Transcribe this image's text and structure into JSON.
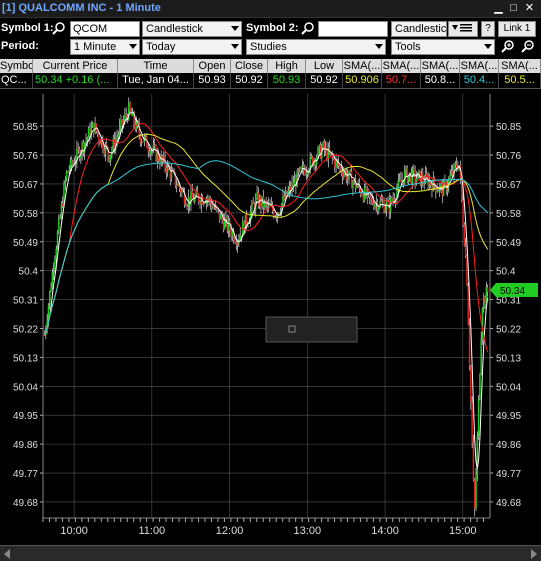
{
  "window": {
    "title": "[1] QUALCOMM INC - 1 Minute",
    "buttons": [
      "▁",
      "□",
      "✕"
    ]
  },
  "toolbar": {
    "symbol1_label": "Symbol 1:",
    "symbol1_value": "QCOM",
    "chart_type": "Candlestick",
    "symbol2_label": "Symbol 2:",
    "symbol2_value": "",
    "chart_type2": "Candlestic",
    "help_label": "?",
    "link_label": "Link 1",
    "period_label": "Period:",
    "period_value": "1 Minute",
    "range_value": "Today",
    "studies_label": "Studies",
    "tools_label": "Tools"
  },
  "table": {
    "headers": [
      "Symbol",
      "Current Price",
      "Time",
      "Open",
      "Close",
      "High",
      "Low",
      "SMA(...",
      "SMA(...",
      "SMA(...",
      "SMA(...",
      "SMA(..."
    ],
    "row": [
      "QC...",
      "50.34",
      "+0.16 (...",
      "Tue, Jan 04...",
      "50.93",
      "50.92",
      "50.93",
      "50.92",
      "50.906",
      "50.7...",
      "50.8...",
      "50.4...",
      "50.5..."
    ]
  },
  "chart_data": {
    "type": "candlestick",
    "y_ticks": [
      "50.85",
      "50.76",
      "50.67",
      "50.58",
      "50.49",
      "50.4",
      "50.31",
      "50.22",
      "50.13",
      "50.04",
      "49.95",
      "49.86",
      "49.77",
      "49.68"
    ],
    "ylim": [
      49.63,
      50.95
    ],
    "x_ticks": [
      "10:00",
      "11:00",
      "12:00",
      "13:00",
      "14:00",
      "15:00"
    ],
    "current_price_label": "50.34",
    "colors": {
      "up": "#22cc22",
      "down": "#dd2222",
      "sma1": "#ffffff",
      "sma2": "#ff2020",
      "sma3": "#e8e830",
      "sma4": "#30c8d8",
      "grid": "#555555"
    }
  }
}
